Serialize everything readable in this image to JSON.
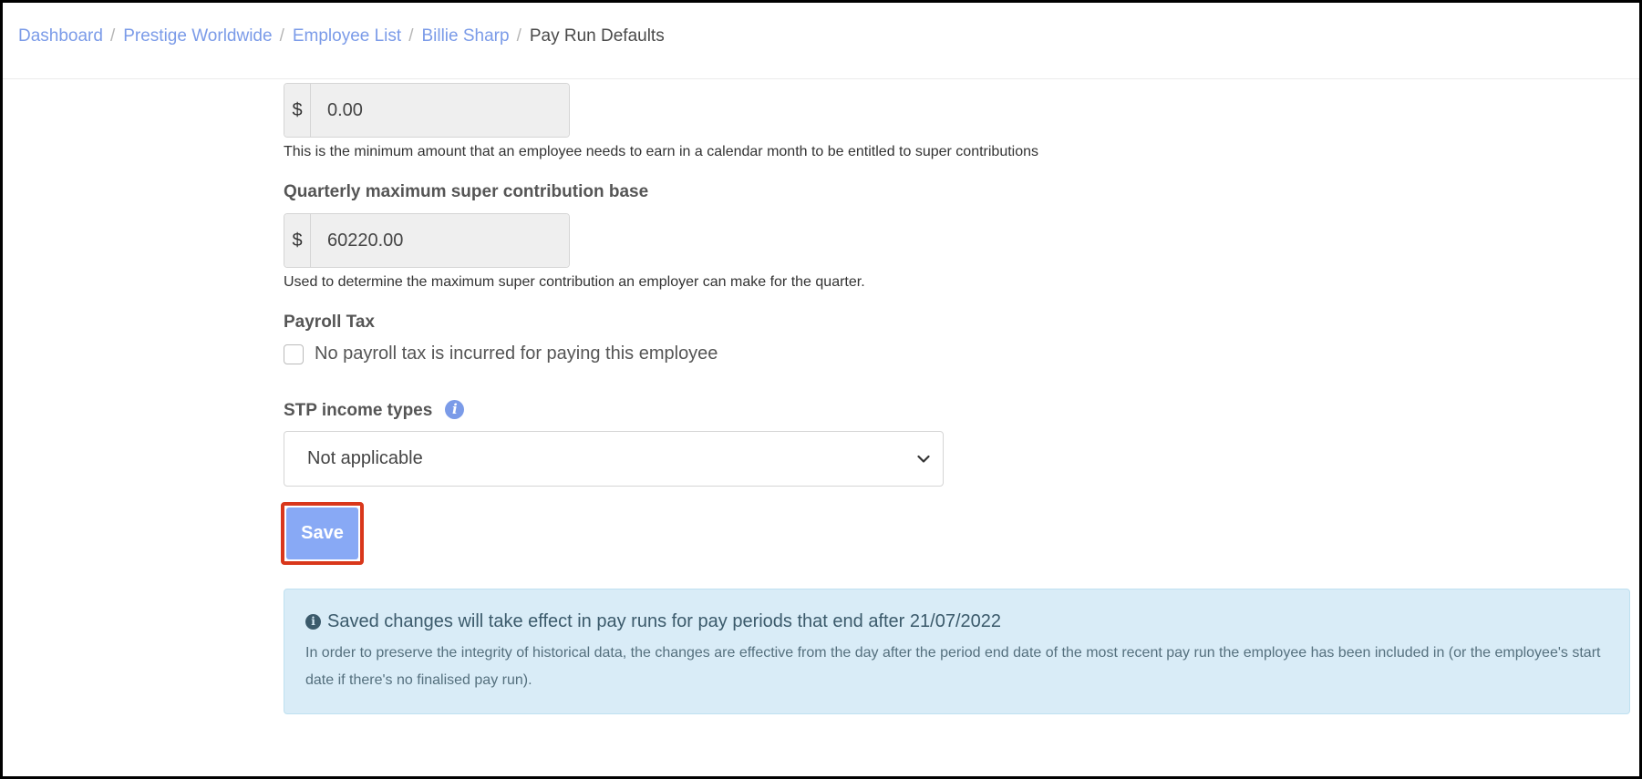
{
  "breadcrumb": {
    "items": [
      "Dashboard",
      "Prestige Worldwide",
      "Employee List",
      "Billie Sharp"
    ],
    "current": "Pay Run Defaults",
    "separator": "/"
  },
  "monthly_threshold": {
    "currency_symbol": "$",
    "value": "0.00",
    "help": "This is the minimum amount that an employee needs to earn in a calendar month to be entitled to super contributions"
  },
  "quarterly_max": {
    "label": "Quarterly maximum super contribution base",
    "currency_symbol": "$",
    "value": "60220.00",
    "help": "Used to determine the maximum super contribution an employer can make for the quarter."
  },
  "payroll_tax": {
    "label": "Payroll Tax",
    "checkbox_label": "No payroll tax is incurred for paying this employee",
    "checked": false
  },
  "stp_income_types": {
    "label": "STP income types",
    "info_icon": "info-circle-icon",
    "selected": "Not applicable"
  },
  "save_label": "Save",
  "notice": {
    "icon": "info-circle-icon",
    "title": "Saved changes will take effect in pay runs for pay periods that end after 21/07/2022",
    "body": "In order to preserve the integrity of historical data, the changes are effective from the day after the period end date of the most recent pay run the employee has been included in (or the employee's start date if there's no finalised pay run)."
  },
  "colors": {
    "link": "#7b9be8",
    "save_button": "#88a9f5",
    "highlight_outline": "#d9371b",
    "notice_bg": "#d9ecf7"
  }
}
